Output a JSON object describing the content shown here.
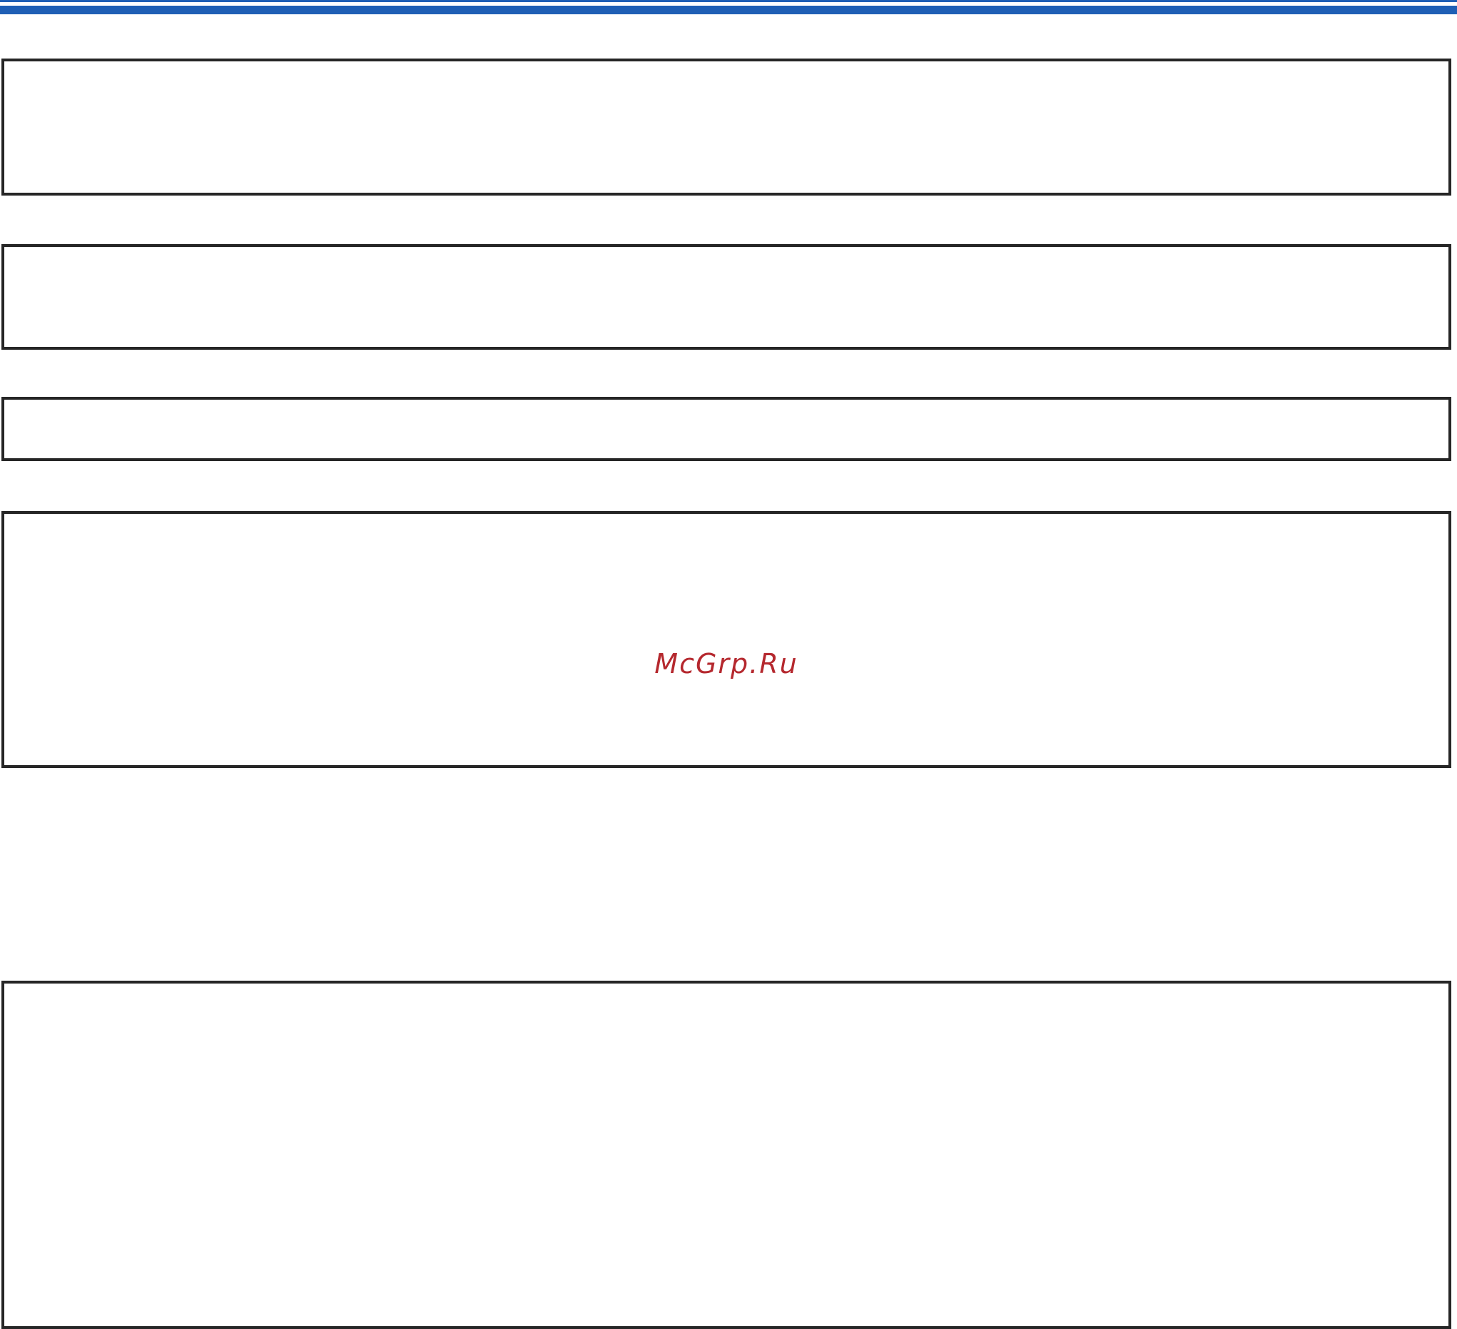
{
  "watermark": {
    "text": "McGrp.Ru",
    "color": "#b5282e"
  },
  "colors": {
    "header_rule": "#1f5fb5",
    "box_border": "#262626"
  }
}
